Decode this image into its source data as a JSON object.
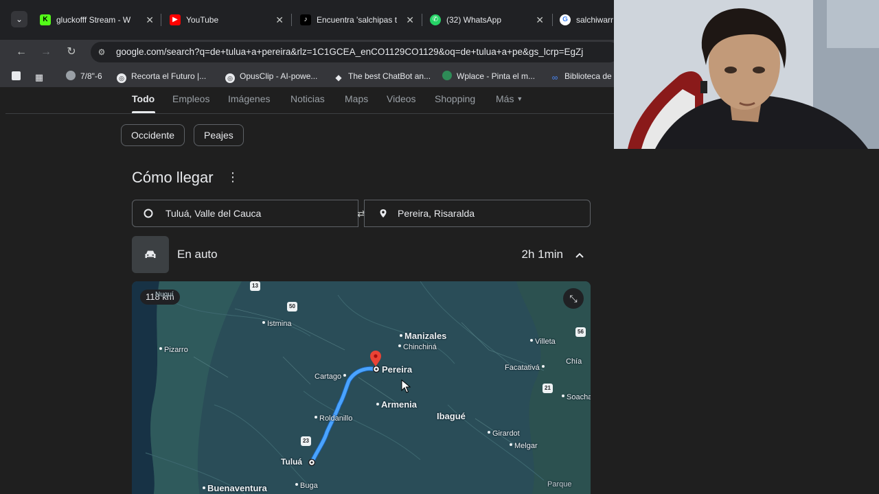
{
  "tabs": [
    {
      "label": "gluckofff Stream - W",
      "favicon": "kick-icon",
      "color": "#53fc18"
    },
    {
      "label": "YouTube",
      "favicon": "youtube-icon",
      "color": "#ff0000"
    },
    {
      "label": "Encuentra 'salchipas t",
      "favicon": "tiktok-icon",
      "color": "#000000"
    },
    {
      "label": "(32) WhatsApp",
      "favicon": "whatsapp-icon",
      "color": "#25d366"
    },
    {
      "label": "salchiwarr",
      "favicon": "google-icon",
      "color": "#ffffff"
    }
  ],
  "address": {
    "url": "google.com/search?q=de+tulua+a+pereira&rlz=1C1GCEA_enCO1129CO1129&oq=de+tulua+a+pe&gs_lcrp=EgZj"
  },
  "bookmarks": [
    {
      "label": "7/8\"-6",
      "icon": "globe-icon"
    },
    {
      "label": "Recorta el Futuro |...",
      "icon": "opusclip-icon"
    },
    {
      "label": "OpusClip - AI-powe...",
      "icon": "opusclip-icon"
    },
    {
      "label": "The best ChatBot an...",
      "icon": "chatbot-icon"
    },
    {
      "label": "Wplace - Pinta el m...",
      "icon": "wplace-icon"
    },
    {
      "label": "Biblioteca de",
      "icon": "meta-icon"
    }
  ],
  "search_tabs": [
    "Todo",
    "Empleos",
    "Imágenes",
    "Noticias",
    "Maps",
    "Videos",
    "Shopping",
    "Más"
  ],
  "chips": [
    "Occidente",
    "Peajes"
  ],
  "directions": {
    "heading": "Cómo llegar",
    "origin": "Tuluá, Valle del Cauca",
    "destination": "Pereira, Risaralda",
    "mode": "En auto",
    "duration": "2h 1min"
  },
  "map": {
    "distance": "118 km",
    "cities": [
      "Manizales",
      "Chinchiná",
      "Pereira",
      "Cartago",
      "Armenia",
      "Ibagué",
      "Roldanillo",
      "Tuluá",
      "Buenaventura",
      "Buga",
      "Istmina",
      "Pizarro",
      "Villeta",
      "Facatativá",
      "Girardot",
      "Melgar",
      "Chía",
      "Soacha",
      "Parque",
      "Nuquí"
    ],
    "shields": [
      "13",
      "50",
      "56",
      "21",
      "23"
    ]
  },
  "colors": {
    "route": "#4aa3ff",
    "pin": "#ea4335"
  }
}
